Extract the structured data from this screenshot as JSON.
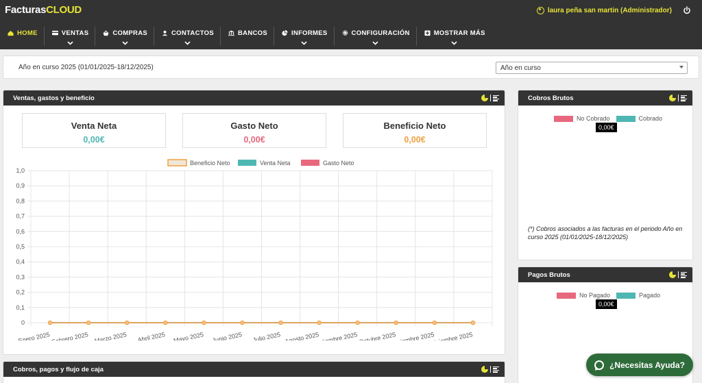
{
  "app": {
    "logo_main": "Facturas",
    "logo_accent": "CLOUD"
  },
  "user": {
    "name": "laura peña san martin (Administrador)"
  },
  "nav": [
    {
      "label": "HOME",
      "icon": "home-icon",
      "dropdown": false,
      "active": true
    },
    {
      "label": "VENTAS",
      "icon": "card-icon",
      "dropdown": true,
      "active": false
    },
    {
      "label": "COMPRAS",
      "icon": "basket-icon",
      "dropdown": true,
      "active": false
    },
    {
      "label": "CONTACTOS",
      "icon": "user-icon",
      "dropdown": true,
      "active": false
    },
    {
      "label": "BANCOS",
      "icon": "bank-icon",
      "dropdown": false,
      "active": false
    },
    {
      "label": "INFORMES",
      "icon": "pie-chart-icon",
      "dropdown": true,
      "active": false
    },
    {
      "label": "CONFIGURACIÓN",
      "icon": "gear-icon",
      "dropdown": true,
      "active": false
    },
    {
      "label": "MOSTRAR MÁS",
      "icon": "plus-square-icon",
      "dropdown": true,
      "active": false
    }
  ],
  "period": {
    "label": "Año en curso 2025 (01/01/2025-18/12/2025)",
    "select_value": "Año en curso"
  },
  "main_panel": {
    "title": "Ventas, gastos y beneficio",
    "kpis": [
      {
        "title": "Venta Neta",
        "value": "0,00€",
        "color": "#4fb7b3"
      },
      {
        "title": "Gasto Neto",
        "value": "0,00€",
        "color": "#e8687e"
      },
      {
        "title": "Beneficio Neto",
        "value": "0,00€",
        "color": "#f0a040"
      }
    ]
  },
  "chart_data": {
    "type": "line",
    "categories": [
      "Enero 2025",
      "Febrero 2025",
      "Marzo 2025",
      "Abril 2025",
      "Mayo 2025",
      "Junio 2025",
      "Julio 2025",
      "Agosto 2025",
      "Septiembre 2025",
      "Octubre 2025",
      "Noviembre 2025",
      "Diciembre 2025"
    ],
    "series": [
      {
        "name": "Beneficio Neto",
        "values": [
          0,
          0,
          0,
          0,
          0,
          0,
          0,
          0,
          0,
          0,
          0,
          0
        ],
        "color": "#f0a040"
      },
      {
        "name": "Venta Neta",
        "values": [
          0,
          0,
          0,
          0,
          0,
          0,
          0,
          0,
          0,
          0,
          0,
          0
        ],
        "color": "#4fb7b3"
      },
      {
        "name": "Gasto Neto",
        "values": [
          0,
          0,
          0,
          0,
          0,
          0,
          0,
          0,
          0,
          0,
          0,
          0
        ],
        "color": "#e8687e"
      }
    ],
    "ylim": [
      0,
      1
    ],
    "yticks": [
      "1,0",
      "0,9",
      "0,8",
      "0,7",
      "0,6",
      "0,5",
      "0,4",
      "0,3",
      "0,2",
      "0,1",
      "0"
    ],
    "grid": true,
    "legend": "top"
  },
  "cobros_panel": {
    "title": "Cobros Brutos",
    "legend": [
      {
        "label": "No Cobrado",
        "color": "#e8687e"
      },
      {
        "label": "Cobrado",
        "color": "#4fb7b3"
      }
    ],
    "tooltip": "0,00€",
    "note": "(*) Cobros asociados a las facturas en el periodo Año en curso 2025 (01/01/2025-18/12/2025)"
  },
  "pagos_panel": {
    "title": "Pagos Brutos",
    "legend": [
      {
        "label": "No Pagado",
        "color": "#e8687e"
      },
      {
        "label": "Pagado",
        "color": "#4fb7b3"
      }
    ],
    "tooltip": "0,00€"
  },
  "flujo_panel": {
    "title": "Cobros, pagos y flujo de caja"
  },
  "help": {
    "label": "¿Necesitas Ayuda?"
  }
}
